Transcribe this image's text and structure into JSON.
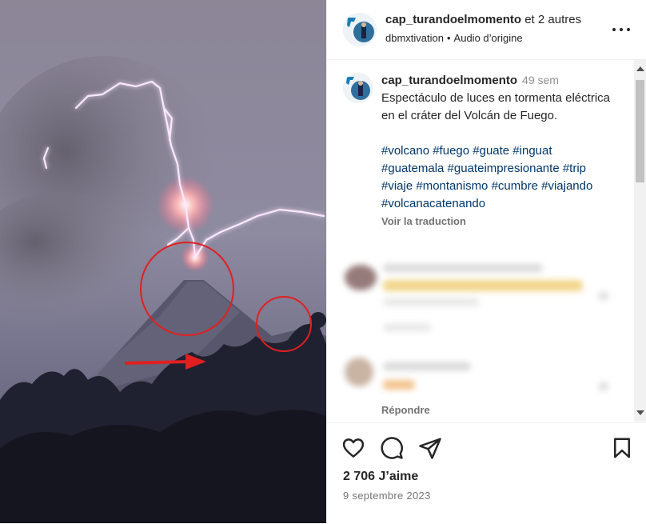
{
  "post": {
    "media_alt": "Volcano eruption with lightning",
    "header": {
      "username": "cap_turandoelmomento",
      "coauthors": "et 2 autres",
      "audio_user": "dbmxtivation",
      "audio_label": "Audio d’origine"
    },
    "caption": {
      "username": "cap_turandoelmomento",
      "time": "49 sem",
      "text": "Espectáculo de luces en tormenta eléctrica en el cráter del Volcán de Fuego.",
      "hashtags": "#volcano #fuego #guate #inguat #guatemala #guateimpresionante #trip #viaje #montanismo #cumbre #viajando #volcanacatenando",
      "translate": "Voir la traduction"
    },
    "comments": {
      "reply_label": "Répondre"
    },
    "actions": {
      "likes": "2 706 J’aime",
      "date": "9 septembre 2023"
    }
  },
  "colors": {
    "hashtag": "#00376b",
    "annotation_red": "#e02020"
  },
  "icons": [
    "heart-icon",
    "comment-icon",
    "share-icon",
    "bookmark-icon",
    "more-options-icon"
  ]
}
